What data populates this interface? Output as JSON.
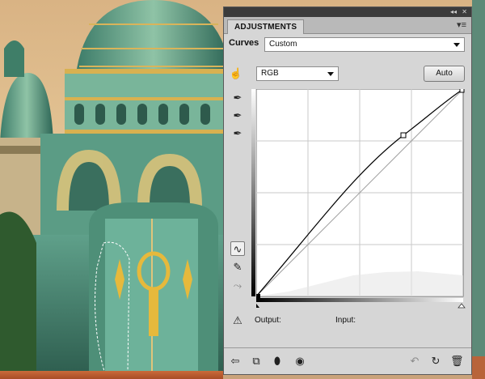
{
  "panel": {
    "tab_label": "ADJUSTMENTS",
    "curves_label": "Curves",
    "preset_value": "Custom",
    "channel_value": "RGB",
    "auto_button": "Auto",
    "output_label": "Output:",
    "input_label": "Input:",
    "panel_menu_icon": "panel-menu-icon",
    "collapse_icon": "double-arrow-icon",
    "close_icon": "close-icon"
  },
  "curve": {
    "points_in": [
      0,
      189,
      255
    ],
    "points_out": [
      0,
      200,
      255
    ],
    "grid": "4x4",
    "histogram": true
  },
  "tools": [
    "on-image-adjust-icon",
    "black-eyedropper-icon",
    "gray-eyedropper-icon",
    "white-eyedropper-icon",
    "curve-points-icon",
    "pencil-icon",
    "smooth-icon",
    "clipping-warning-icon"
  ],
  "bottom_icons": [
    "back-arrow-icon",
    "expand-view-icon",
    "clip-layer-icon",
    "visibility-eye-icon",
    "previous-state-icon",
    "reset-icon",
    "delete-icon"
  ],
  "colors": {
    "panel_bg": "#d6d6d6",
    "title_bar": "#3b3b3b",
    "graph_bg": "#ffffff",
    "grid": "#c8c8c8"
  }
}
